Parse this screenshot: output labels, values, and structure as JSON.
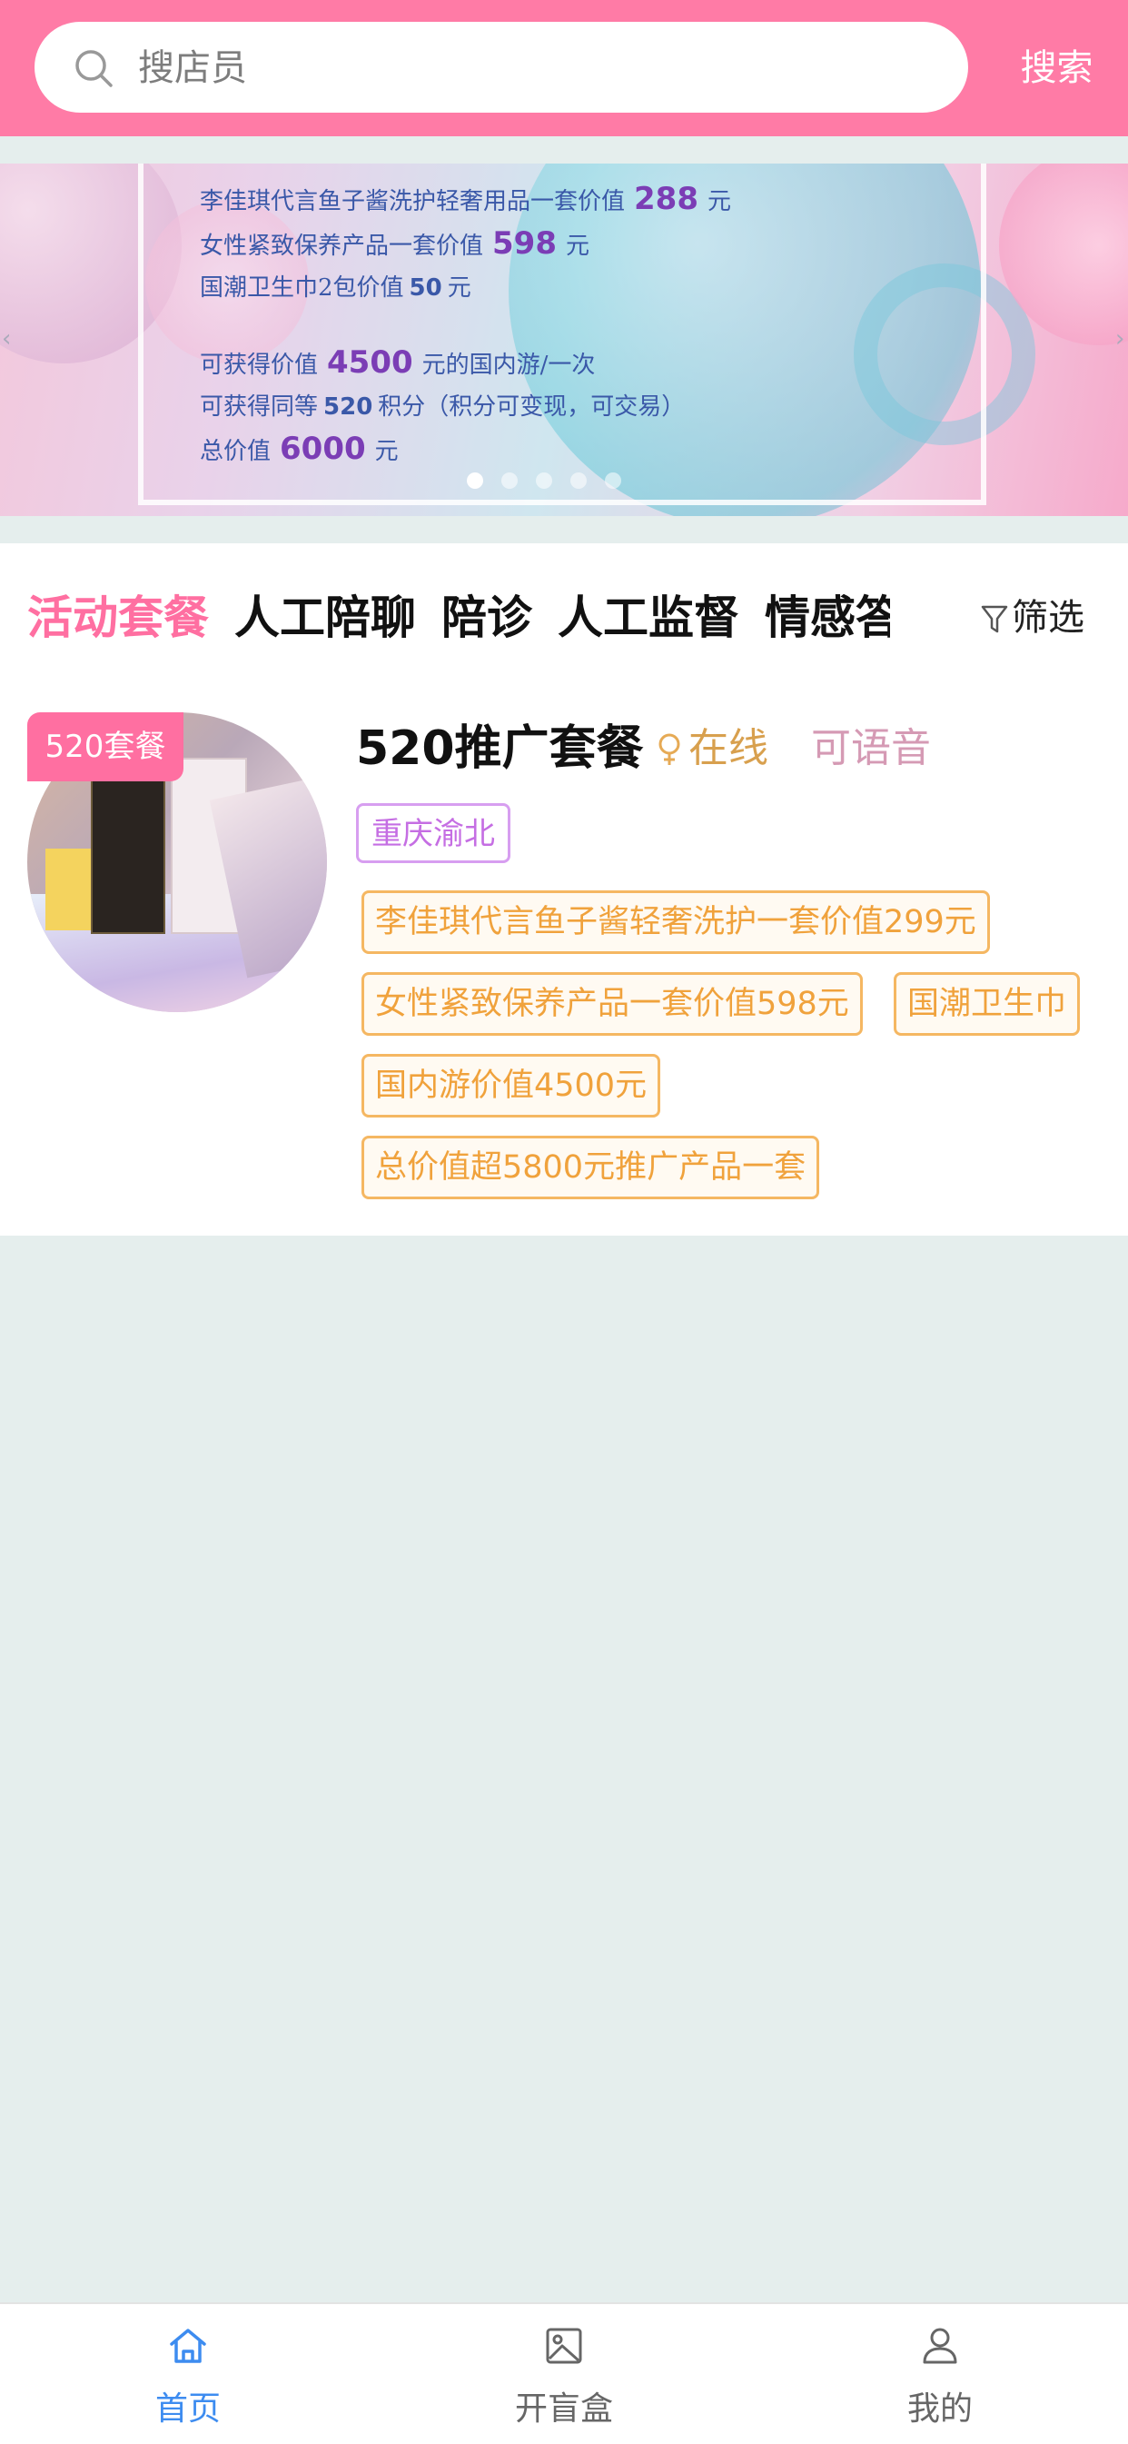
{
  "search": {
    "placeholder": "搜店员",
    "button_label": "搜索"
  },
  "banner": {
    "lines": [
      {
        "pre": "李佳琪代言鱼子酱洗护轻奢用品一套价值",
        "num": "288",
        "post": "元"
      },
      {
        "pre": "女性紧致保养产品一套价值",
        "num": "598",
        "post": "元"
      },
      {
        "pre": "国潮卫生巾2包价值",
        "num": "50",
        "post": "元"
      },
      {
        "pre": "可获得价值",
        "num": "4500",
        "post": "元的国内游/一次"
      },
      {
        "pre": "可获得同等",
        "num": "520",
        "post": "积分（积分可变现，可交易）"
      },
      {
        "pre": "总价值",
        "num": "6000",
        "post": "元"
      }
    ],
    "active_dot": 1,
    "dot_count": 5
  },
  "tabs": [
    "活动套餐",
    "人工陪聊",
    "陪诊",
    "人工监督",
    "情感答疑"
  ],
  "active_tab": 0,
  "filter_label": "筛选",
  "card": {
    "badge": "520套餐",
    "title": "520推广套餐",
    "status": "在线",
    "voice": "可语音",
    "location": "重庆渝北",
    "tags": [
      "李佳琪代言鱼子酱轻奢洗护一套价值299元",
      "女性紧致保养产品一套价值598元",
      "国潮卫生巾",
      "国内游价值4500元",
      "总价值超5800元推广产品一套"
    ]
  },
  "nav": [
    {
      "label": "首页",
      "icon": "home-icon"
    },
    {
      "label": "开盲盒",
      "icon": "image-icon"
    },
    {
      "label": "我的",
      "icon": "user-icon"
    }
  ],
  "colors": {
    "brand": "#ff7ba6",
    "accent": "#ff6fa1",
    "tag_orange": "#f0a23c",
    "nav_active": "#3d8cf0",
    "background": "#e5eeed"
  }
}
